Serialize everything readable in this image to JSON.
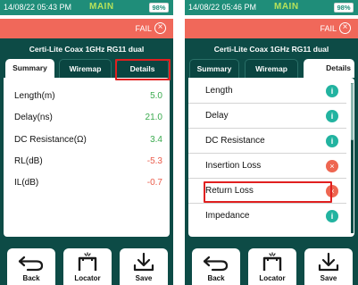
{
  "left": {
    "status": {
      "time": "14/08/22 05:43 PM",
      "mode": "MAIN",
      "battery": "98%"
    },
    "fail_label": "FAIL",
    "test_title": "Certi-Lite Coax 1GHz RG11 dual",
    "tabs": [
      "Summary",
      "Wiremap",
      "Details"
    ],
    "active_tab": "Summary",
    "highlighted_tab": "Details",
    "measurements": [
      {
        "label": "Length(m)",
        "value": "5.0",
        "status": "pass"
      },
      {
        "label": "Delay(ns)",
        "value": "21.0",
        "status": "pass"
      },
      {
        "label": "DC Resistance(Ω)",
        "value": "3.4",
        "status": "pass"
      },
      {
        "label": "RL(dB)",
        "value": "-5.3",
        "status": "fail"
      },
      {
        "label": "IL(dB)",
        "value": "-0.7",
        "status": "fail"
      }
    ],
    "buttons": {
      "back": "Back",
      "locator": "Locator",
      "save": "Save"
    }
  },
  "right": {
    "status": {
      "time": "14/08/22 05:46 PM",
      "mode": "MAIN",
      "battery": "98%"
    },
    "fail_label": "FAIL",
    "test_title": "Certi-Lite Coax 1GHz RG11 dual",
    "tabs": [
      "Summary",
      "Wiremap",
      "Details"
    ],
    "active_tab": "Details",
    "details": [
      {
        "label": "Length",
        "indicator": "i",
        "status": "info"
      },
      {
        "label": "Delay",
        "indicator": "i",
        "status": "info"
      },
      {
        "label": "DC Resistance",
        "indicator": "i",
        "status": "info"
      },
      {
        "label": "Insertion Loss",
        "indicator": "×",
        "status": "fail"
      },
      {
        "label": "Return Loss",
        "indicator": "×",
        "status": "fail"
      },
      {
        "label": "Impedance",
        "indicator": "i",
        "status": "info"
      }
    ],
    "highlighted_item": "Return Loss",
    "buttons": {
      "back": "Back",
      "locator": "Locator",
      "save": "Save"
    }
  },
  "colors": {
    "status_bar": "#1f8d79",
    "fail_bar": "#f0685a",
    "dark_background": "#0d4b46",
    "pass_value": "#3aaa4e",
    "fail_value": "#ea5b4a",
    "info_indicator": "#22b3a0",
    "fail_indicator": "#ee6651",
    "highlight": "#e02020"
  },
  "icons": {
    "fail": "circle-x-icon",
    "back": "return-arrow-icon",
    "locator": "locator-bracket-icon",
    "save": "download-tray-icon",
    "info": "info-circle-icon",
    "error": "error-circle-x-icon"
  }
}
